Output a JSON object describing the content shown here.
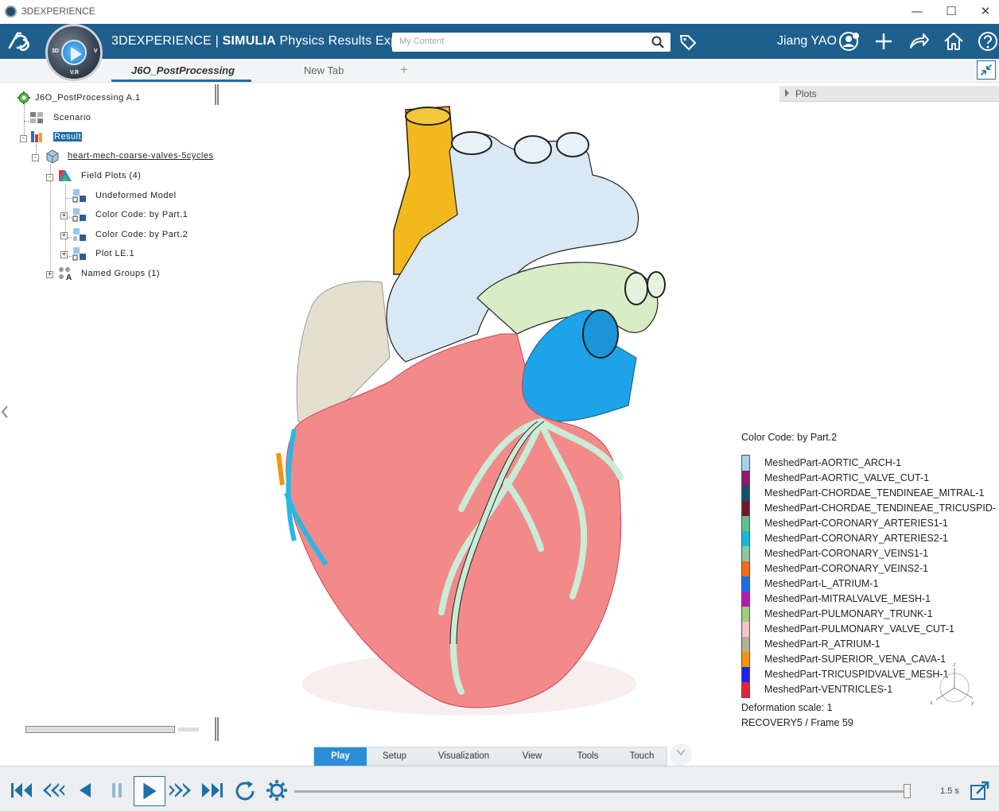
{
  "window": {
    "title": "3DEXPERIENCE",
    "controls": [
      "minimize-icon",
      "maximize-icon",
      "close-icon"
    ]
  },
  "topbar": {
    "brand_prefix": "3DEXPERIENCE",
    "brand_sep": " | ",
    "brand_bold": "SIMULIA",
    "app_name": " Physics Results Exp...",
    "search_placeholder": "My Content",
    "user": "Jiang YAO",
    "compass": {
      "label_3d": "3D",
      "label_vr": "V.R",
      "label_v": "V"
    }
  },
  "tabs": {
    "items": [
      {
        "label": "J6O_PostProcessing",
        "active": true
      },
      {
        "label": "New Tab",
        "active": false
      }
    ],
    "add_label": "+"
  },
  "tree": {
    "root": "J6O_PostProcessing A.1",
    "scenario": "Scenario",
    "result": "Result",
    "model": "heart-mech-coarse-valves-5cycles",
    "field_plots": "Field Plots (4)",
    "fp_items": [
      "Undeformed Model",
      "Color Code: by Part.1",
      "Color Code: by Part.2",
      "Plot LE.1"
    ],
    "named_groups": "Named Groups (1)"
  },
  "plots_panel": {
    "label": "Plots"
  },
  "legend": {
    "title": "Color Code: by Part.2",
    "items": [
      {
        "label": "MeshedPart-AORTIC_ARCH-1",
        "color": "#a9cfe9"
      },
      {
        "label": "MeshedPart-AORTIC_VALVE_CUT-1",
        "color": "#8b1a6b"
      },
      {
        "label": "MeshedPart-CHORDAE_TENDINEAE_MITRAL-1",
        "color": "#134e6e"
      },
      {
        "label": "MeshedPart-CHORDAE_TENDINEAE_TRICUSPID-",
        "color": "#6a1b2a"
      },
      {
        "label": "MeshedPart-CORONARY_ARTERIES1-1",
        "color": "#5fc08a"
      },
      {
        "label": "MeshedPart-CORONARY_ARTERIES2-1",
        "color": "#18b6e0"
      },
      {
        "label": "MeshedPart-CORONARY_VEINS1-1",
        "color": "#8cc6a2"
      },
      {
        "label": "MeshedPart-CORONARY_VEINS2-1",
        "color": "#f06b1c"
      },
      {
        "label": "MeshedPart-L_ATRIUM-1",
        "color": "#1b6fe0"
      },
      {
        "label": "MeshedPart-MITRALVALVE_MESH-1",
        "color": "#b01cae"
      },
      {
        "label": "MeshedPart-PULMONARY_TRUNK-1",
        "color": "#a3c97a"
      },
      {
        "label": "MeshedPart-PULMONARY_VALVE_CUT-1",
        "color": "#f4c3c3"
      },
      {
        "label": "MeshedPart-R_ATRIUM-1",
        "color": "#b3b195"
      },
      {
        "label": "MeshedPart-SUPERIOR_VENA_CAVA-1",
        "color": "#f2950e"
      },
      {
        "label": "MeshedPart-TRICUSPIDVALVE_MESH-1",
        "color": "#1d22e6"
      },
      {
        "label": "MeshedPart-VENTRICLES-1",
        "color": "#e0243a"
      }
    ],
    "deformation": "Deformation scale: 1",
    "frame": "RECOVERY5 / Frame 59"
  },
  "viewport": {
    "colors": {
      "aorta": "#d8e8f4",
      "svc": "#f3b81b",
      "pulmonary_trunk": "#d8ecc6",
      "left_atrium": "#1ea2e8",
      "right_atrium": "#e3e0d0",
      "ventricles": "#f28a8a",
      "coronary_veins": "#c9ecd6",
      "coronary_arteries": "#27b8e6"
    }
  },
  "action_bar": {
    "tabs": [
      {
        "label": "Play",
        "active": true
      },
      {
        "label": "Setup",
        "active": false
      },
      {
        "label": "Visualization",
        "active": false
      },
      {
        "label": "View",
        "active": false
      },
      {
        "label": "Tools",
        "active": false
      },
      {
        "label": "Touch",
        "active": false
      }
    ]
  },
  "player": {
    "buttons": [
      "first-frame",
      "rewind",
      "step-back",
      "pause",
      "play",
      "fast-forward",
      "last-frame",
      "loop",
      "settings"
    ],
    "speed": "1.5 s",
    "progress": 1.0
  }
}
